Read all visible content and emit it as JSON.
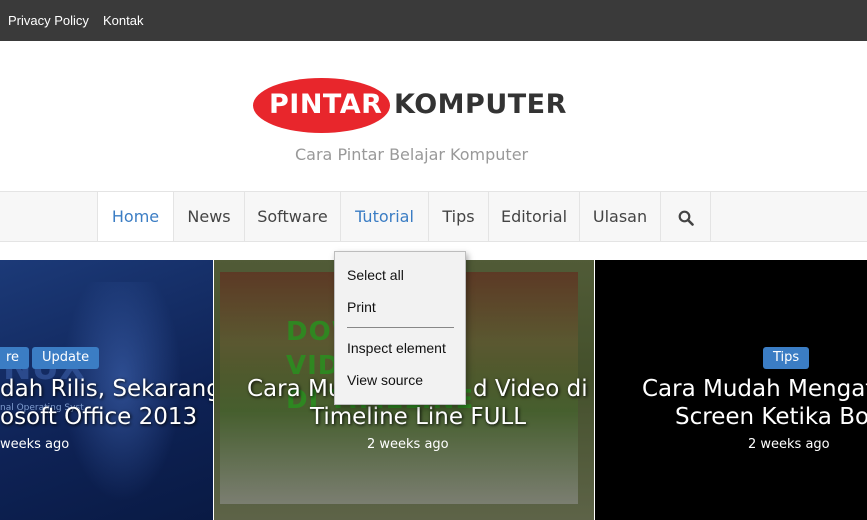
{
  "topbar": {
    "links": [
      "Privacy Policy",
      "Kontak"
    ]
  },
  "header": {
    "logo_pill_text": "PINTAR",
    "logo_text": "KOMPUTER",
    "tagline": "Cara Pintar Belajar Komputer"
  },
  "nav": {
    "items": [
      "Home",
      "News",
      "Software",
      "Tutorial",
      "Tips",
      "Editorial",
      "Ulasan"
    ],
    "active": "Home",
    "search_icon": "search-icon"
  },
  "cards": [
    {
      "badges": [
        "re",
        "Update"
      ],
      "title_lines": [
        "dah Rilis, Sekarang",
        "osoft Office 2013"
      ],
      "small_text": "nal Operating Syst",
      "bg_text": "NUX",
      "time": "weeks ago"
    },
    {
      "image_text": [
        "DOWNLOAD VIDEO",
        "DI TIMELINE"
      ],
      "title_lines": [
        "Cara Mud",
        "d Video di",
        "Timeline Line FULL"
      ],
      "time": "2 weeks ago"
    },
    {
      "badges": [
        "Tips"
      ],
      "title_lines": [
        "Cara Mudah Mengatasi",
        "Screen Ketika Booti"
      ],
      "time": "2 weeks ago"
    }
  ],
  "context_menu": {
    "items": [
      "Select all",
      "Print",
      "Inspect element",
      "View source"
    ]
  },
  "colors": {
    "brand_red": "#e8262c",
    "accent_blue": "#3b7dc4",
    "topbar": "#3a3a3a"
  }
}
